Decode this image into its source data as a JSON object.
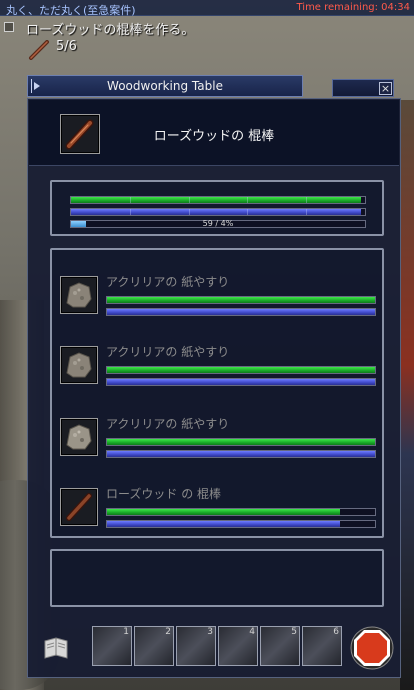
{
  "quest_bar": {
    "quest_name": "丸く、ただ丸く(至急案件)",
    "timer": "Time remaining: 04:34"
  },
  "tracker": {
    "title": "ローズウッドの棍棒を作る。",
    "count": "5/6",
    "icon": "club-icon"
  },
  "window": {
    "title": "Woodworking Table",
    "close_label": "×"
  },
  "product": {
    "name": "ローズウッドの 棍棒",
    "icon": "rosewood-club-icon"
  },
  "progress": {
    "bar1_fill": 0.985,
    "bar2_fill": 0.985,
    "bar3_fill": 0.05,
    "text": "59 / 4%"
  },
  "materials": [
    {
      "name": "アクリリアの 紙やすり",
      "icon": "sandpaper-icon",
      "green_fill": 1.0,
      "blue_fill": 1.0
    },
    {
      "name": "アクリリアの 紙やすり",
      "icon": "sandpaper-icon",
      "green_fill": 1.0,
      "blue_fill": 1.0
    },
    {
      "name": "アクリリアの 紙やすり",
      "icon": "sandpaper-icon",
      "green_fill": 1.0,
      "blue_fill": 1.0
    },
    {
      "name": "ローズウッド の 棍棒",
      "icon": "rosewood-club-icon",
      "green_fill": 0.87,
      "blue_fill": 0.87
    }
  ],
  "toolbar": {
    "slots": [
      "1",
      "2",
      "3",
      "4",
      "5",
      "6"
    ],
    "book_icon": "recipe-book-icon",
    "stop_icon": "stop-octagon-icon"
  },
  "colors": {
    "timer": "#ff5a4a",
    "quest": "#a8c4ff",
    "progress_green": "#22c032",
    "progress_blue": "#4450d8",
    "stop_red": "#d83a1c"
  }
}
